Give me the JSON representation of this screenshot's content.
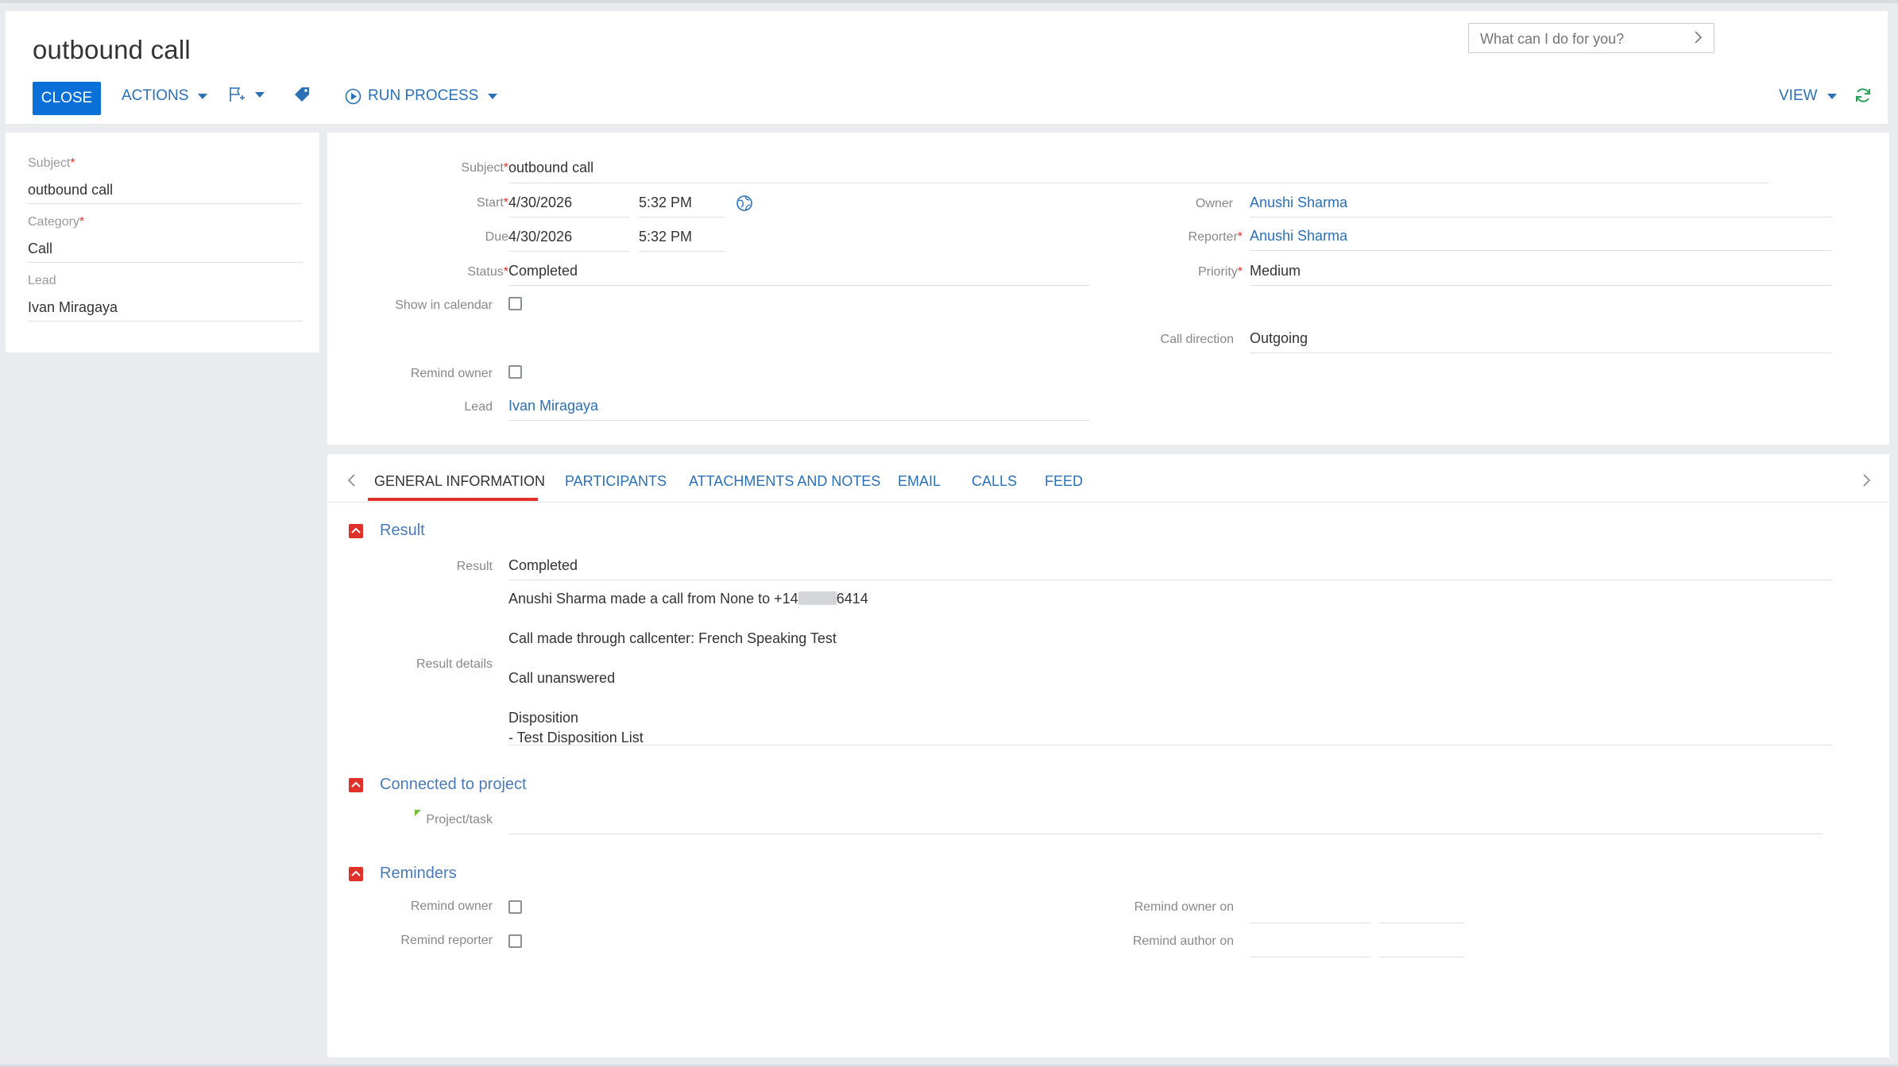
{
  "header": {
    "title": "outbound call",
    "close_label": "CLOSE",
    "actions_label": "ACTIONS",
    "run_process_label": "RUN PROCESS",
    "view_label": "VIEW",
    "search_placeholder": "What can I do for you?"
  },
  "left_panel": {
    "subject_label": "Subject",
    "subject_value": "outbound call",
    "category_label": "Category",
    "category_value": "Call",
    "lead_label": "Lead",
    "lead_value": "Ivan Miragaya"
  },
  "main": {
    "subject_label": "Subject",
    "subject_value": "outbound call",
    "start_label": "Start",
    "start_date": "4/30/2026",
    "start_time": "5:32 PM",
    "due_label": "Due",
    "due_date": "4/30/2026",
    "due_time": "5:32 PM",
    "status_label": "Status",
    "status_value": "Completed",
    "show_in_calendar_label": "Show in calendar",
    "show_in_calendar_checked": false,
    "remind_owner_label": "Remind owner",
    "remind_owner_checked": false,
    "lead_label": "Lead",
    "lead_value": "Ivan Miragaya",
    "owner_label": "Owner",
    "owner_value": "Anushi Sharma",
    "reporter_label": "Reporter",
    "reporter_value": "Anushi Sharma",
    "priority_label": "Priority",
    "priority_value": "Medium",
    "call_direction_label": "Call direction",
    "call_direction_value": "Outgoing"
  },
  "tabs": [
    {
      "label": "GENERAL INFORMATION",
      "active": true
    },
    {
      "label": "PARTICIPANTS"
    },
    {
      "label": "ATTACHMENTS AND NOTES"
    },
    {
      "label": "EMAIL"
    },
    {
      "label": "CALLS"
    },
    {
      "label": "FEED"
    }
  ],
  "result_section": {
    "title": "Result",
    "result_label": "Result",
    "result_value": "Completed",
    "details_label": "Result details",
    "details_line1_prefix": "Anushi Sharma made a call from None to +14",
    "details_line1_suffix": "6414",
    "details_line2": "Call made through callcenter: French Speaking Test",
    "details_line3": "Call unanswered",
    "details_line4": "Disposition",
    "details_line5": "- Test Disposition List"
  },
  "project_section": {
    "title": "Connected to project",
    "project_label": "Project/task"
  },
  "reminders_section": {
    "title": "Reminders",
    "remind_owner_label": "Remind owner",
    "remind_reporter_label": "Remind reporter",
    "remind_owner_on_label": "Remind owner on",
    "remind_author_on_label": "Remind author on"
  },
  "colors": {
    "accent_blue": "#0a6fd6",
    "link_blue": "#2b6fb5",
    "required_red": "#e0302a",
    "refresh_green": "#2ca05a"
  }
}
